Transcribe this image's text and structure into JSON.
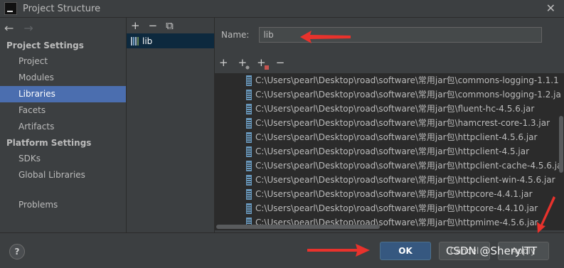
{
  "window": {
    "title": "Project Structure",
    "close": "✕"
  },
  "nav": {
    "back": "←",
    "forward": "→",
    "project_settings_header": "Project Settings",
    "project_settings": [
      "Project",
      "Modules",
      "Libraries",
      "Facets",
      "Artifacts"
    ],
    "platform_settings_header": "Platform Settings",
    "platform_settings": [
      "SDKs",
      "Global Libraries"
    ],
    "problems": "Problems",
    "selected": "Libraries"
  },
  "libraries": {
    "toolbar": {
      "add": "+",
      "remove": "−",
      "copy": "⧉"
    },
    "items": [
      "lib"
    ]
  },
  "detail": {
    "name_label": "Name:",
    "name_value": "lib",
    "toolbar": {
      "add": "+",
      "add_special": "+",
      "add_other": "+",
      "remove": "−"
    },
    "paths": [
      "C:\\Users\\pearl\\Desktop\\road\\software\\常用jar包\\commons-logging-1.1.1",
      "C:\\Users\\pearl\\Desktop\\road\\software\\常用jar包\\commons-logging-1.2.ja",
      "C:\\Users\\pearl\\Desktop\\road\\software\\常用jar包\\fluent-hc-4.5.6.jar",
      "C:\\Users\\pearl\\Desktop\\road\\software\\常用jar包\\hamcrest-core-1.3.jar",
      "C:\\Users\\pearl\\Desktop\\road\\software\\常用jar包\\httpclient-4.5.6.jar",
      "C:\\Users\\pearl\\Desktop\\road\\software\\常用jar包\\httpclient-4.5.jar",
      "C:\\Users\\pearl\\Desktop\\road\\software\\常用jar包\\httpclient-cache-4.5.6.ja",
      "C:\\Users\\pearl\\Desktop\\road\\software\\常用jar包\\httpclient-win-4.5.6.jar",
      "C:\\Users\\pearl\\Desktop\\road\\software\\常用jar包\\httpcore-4.4.1.jar",
      "C:\\Users\\pearl\\Desktop\\road\\software\\常用jar包\\httpcore-4.4.10.jar",
      "C:\\Users\\pearl\\Desktop\\road\\software\\常用jar包\\httpmime-4.5.6.jar"
    ]
  },
  "footer": {
    "help": "?",
    "ok": "OK",
    "cancel": "Cancel",
    "apply": "Apply",
    "watermark": "CSDN @SherylTT"
  },
  "colors": {
    "background": "#3c3f41",
    "selection": "#4b6eaf",
    "list_bg": "#2b2b2b",
    "annotation_arrow": "#e8322c"
  }
}
